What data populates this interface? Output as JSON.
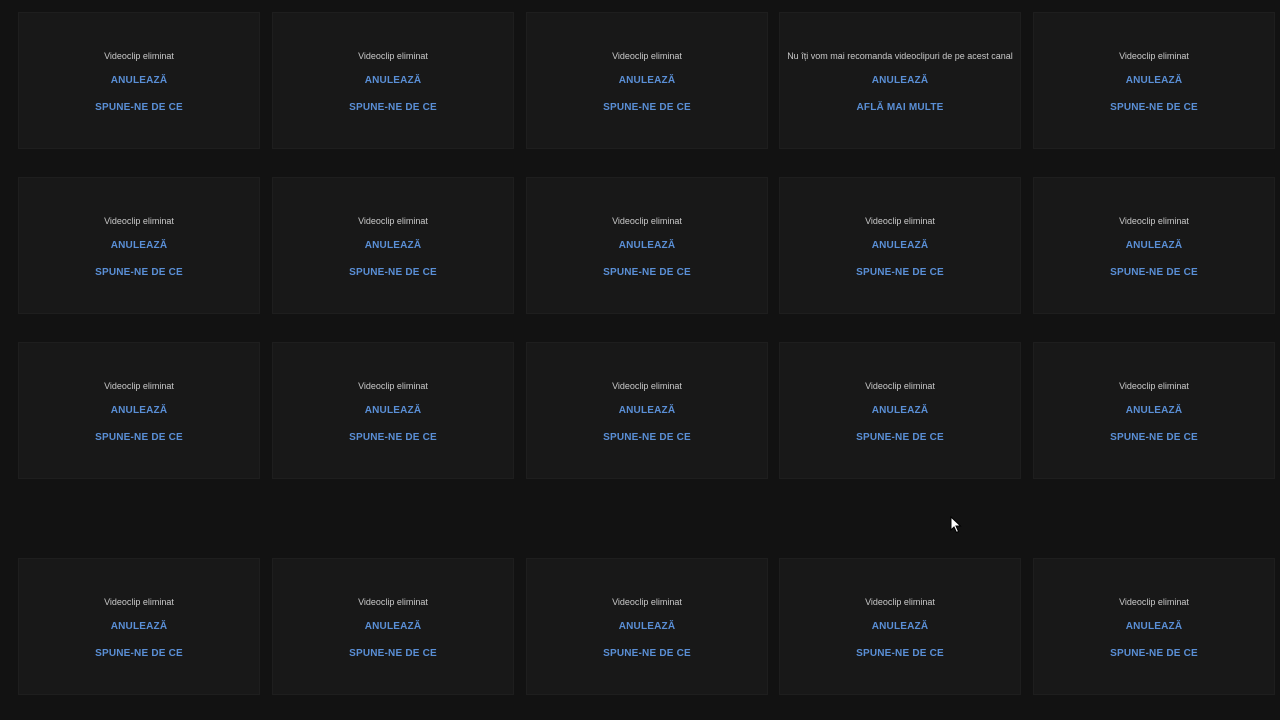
{
  "grid": {
    "rows": [
      [
        {
          "message": "Videoclip eliminat",
          "undo_label": "ANULEAZĂ",
          "more_label": "SPUNE-NE DE CE"
        },
        {
          "message": "Videoclip eliminat",
          "undo_label": "ANULEAZĂ",
          "more_label": "SPUNE-NE DE CE"
        },
        {
          "message": "Videoclip eliminat",
          "undo_label": "ANULEAZĂ",
          "more_label": "SPUNE-NE DE CE"
        },
        {
          "message": "Nu îți vom mai recomanda videoclipuri de pe acest canal",
          "undo_label": "ANULEAZĂ",
          "more_label": "AFLĂ MAI MULTE"
        },
        {
          "message": "Videoclip eliminat",
          "undo_label": "ANULEAZĂ",
          "more_label": "SPUNE-NE DE CE"
        }
      ],
      [
        {
          "message": "Videoclip eliminat",
          "undo_label": "ANULEAZĂ",
          "more_label": "SPUNE-NE DE CE"
        },
        {
          "message": "Videoclip eliminat",
          "undo_label": "ANULEAZĂ",
          "more_label": "SPUNE-NE DE CE"
        },
        {
          "message": "Videoclip eliminat",
          "undo_label": "ANULEAZĂ",
          "more_label": "SPUNE-NE DE CE"
        },
        {
          "message": "Videoclip eliminat",
          "undo_label": "ANULEAZĂ",
          "more_label": "SPUNE-NE DE CE"
        },
        {
          "message": "Videoclip eliminat",
          "undo_label": "ANULEAZĂ",
          "more_label": "SPUNE-NE DE CE"
        }
      ],
      [
        {
          "message": "Videoclip eliminat",
          "undo_label": "ANULEAZĂ",
          "more_label": "SPUNE-NE DE CE"
        },
        {
          "message": "Videoclip eliminat",
          "undo_label": "ANULEAZĂ",
          "more_label": "SPUNE-NE DE CE"
        },
        {
          "message": "Videoclip eliminat",
          "undo_label": "ANULEAZĂ",
          "more_label": "SPUNE-NE DE CE"
        },
        {
          "message": "Videoclip eliminat",
          "undo_label": "ANULEAZĂ",
          "more_label": "SPUNE-NE DE CE"
        },
        {
          "message": "Videoclip eliminat",
          "undo_label": "ANULEAZĂ",
          "more_label": "SPUNE-NE DE CE"
        }
      ],
      [
        {
          "message": "Videoclip eliminat",
          "undo_label": "ANULEAZĂ",
          "more_label": "SPUNE-NE DE CE"
        },
        {
          "message": "Videoclip eliminat",
          "undo_label": "ANULEAZĂ",
          "more_label": "SPUNE-NE DE CE"
        },
        {
          "message": "Videoclip eliminat",
          "undo_label": "ANULEAZĂ",
          "more_label": "SPUNE-NE DE CE"
        },
        {
          "message": "Videoclip eliminat",
          "undo_label": "ANULEAZĂ",
          "more_label": "SPUNE-NE DE CE"
        },
        {
          "message": "Videoclip eliminat",
          "undo_label": "ANULEAZĂ",
          "more_label": "SPUNE-NE DE CE"
        }
      ]
    ]
  },
  "colors": {
    "background": "#121212",
    "tile": "#181818",
    "message_text": "#c8c8c8",
    "link_blue": "#5a8fd6"
  },
  "icons": {
    "cursor": "mouse-pointer-icon"
  }
}
